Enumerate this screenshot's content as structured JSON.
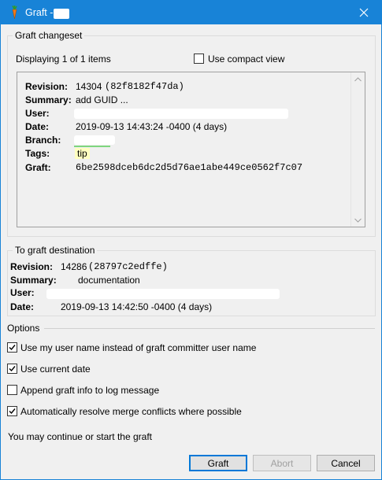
{
  "window": {
    "title": "Graft -",
    "close_icon": "close-icon",
    "app_icon": "carrot-icon"
  },
  "changeset_group": {
    "legend": "Graft changeset",
    "displaying": "Displaying 1 of 1 items",
    "compact_label": "Use compact view",
    "compact_checked": false,
    "revision_label": "Revision:",
    "revision_num": "14304",
    "revision_hash": "(82f8182f47da)",
    "summary_label": "Summary:",
    "summary_value": "add GUID ...",
    "user_label": "User:",
    "date_label": "Date:",
    "date_value": "2019-09-13 14:43:24 -0400 (4 days)",
    "branch_label": "Branch:",
    "tags_label": "Tags:",
    "tags_value": "tip",
    "graft_label": "Graft:",
    "graft_value": "6be2598dceb6dc2d5d76ae1abe449ce0562f7c07"
  },
  "destination_group": {
    "legend": "To graft destination",
    "revision_label": "Revision:",
    "revision_num": "14286",
    "revision_hash": "(28797c2edffe)",
    "summary_label": "Summary:",
    "summary_value": "documentation",
    "user_label": "User:",
    "date_label": "Date:",
    "date_value": "2019-09-13 14:42:50 -0400 (4 days)"
  },
  "options": {
    "heading": "Options",
    "items": [
      {
        "label": "Use my user name instead of graft committer user name",
        "checked": true
      },
      {
        "label": "Use current date",
        "checked": true
      },
      {
        "label": "Append graft info to log message",
        "checked": false
      },
      {
        "label": "Automatically resolve merge conflicts where possible",
        "checked": true
      }
    ]
  },
  "status_text": "You may continue or start the graft",
  "buttons": {
    "graft": "Graft",
    "abort": "Abort",
    "cancel": "Cancel"
  },
  "colors": {
    "titlebar": "#1883d7",
    "tip_tag_bg": "#ffffc0",
    "branch_underline": "#7ed67e",
    "default_button_border": "#0078d7"
  }
}
